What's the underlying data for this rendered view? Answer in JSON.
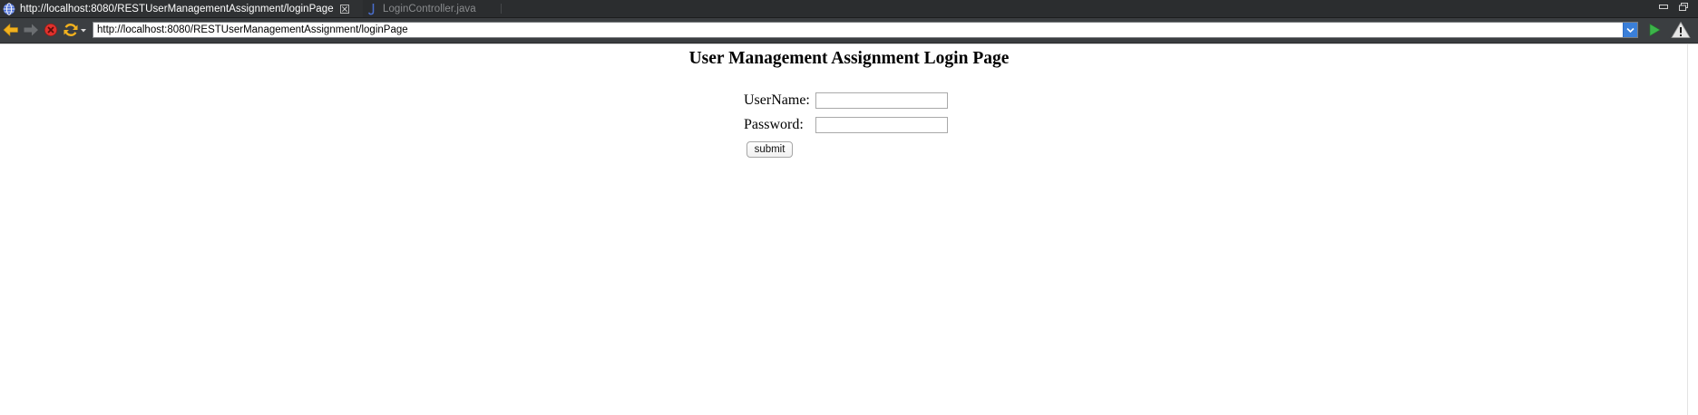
{
  "tabs": [
    {
      "label": "http://localhost:8080/RESTUserManagementAssignment/loginPage",
      "active": true
    },
    {
      "label": "LoginController.java",
      "active": false
    }
  ],
  "toolbar": {
    "url": "http://localhost:8080/RESTUserManagementAssignment/loginPage",
    "icons": [
      "back-arrow-icon",
      "forward-arrow-icon",
      "stop-icon",
      "refresh-icon",
      "go-play-icon",
      "warning-icon"
    ]
  },
  "page": {
    "title": "User Management Assignment Login Page",
    "username_label": "UserName:",
    "password_label": "Password:",
    "username_value": "",
    "password_value": "",
    "submit_label": "submit"
  },
  "colors": {
    "tabbar": "#2b2d2f",
    "toolbar": "#3b3e41",
    "back_arrow": "#f1b11e",
    "stop": "#e0322d",
    "refresh": "#f1b11e",
    "go": "#3cb44a",
    "url_dropdown": "#3a7fd9"
  }
}
